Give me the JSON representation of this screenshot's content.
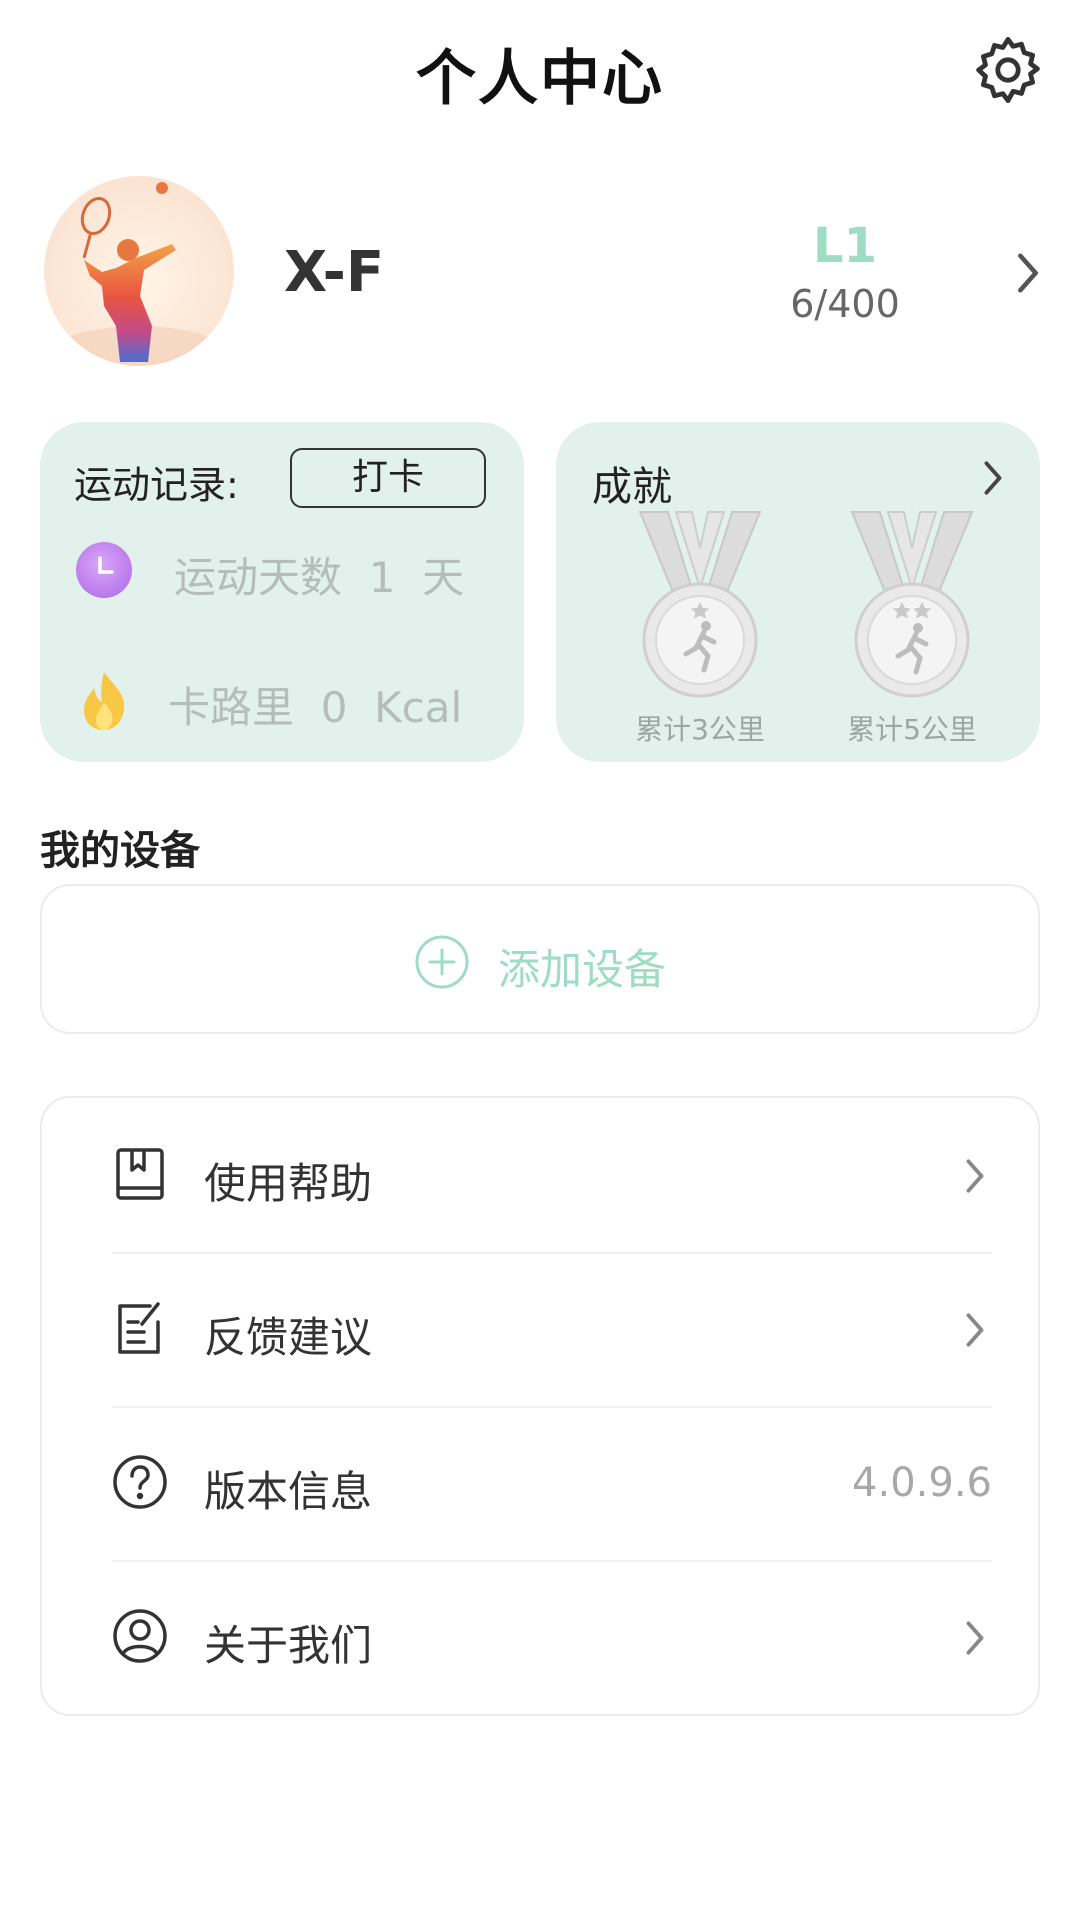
{
  "header": {
    "title": "个人中心"
  },
  "profile": {
    "username": "X-F",
    "level": "L1",
    "level_progress": "6/400"
  },
  "records": {
    "label": "运动记录:",
    "checkin_label": "打卡",
    "days_text": "运动天数  1  天",
    "calories_text": "卡路里  0  Kcal"
  },
  "achievements": {
    "title": "成就",
    "medals": [
      {
        "label": "累计3公里"
      },
      {
        "label": "累计5公里"
      }
    ]
  },
  "devices": {
    "section_title": "我的设备",
    "add_label": "添加设备"
  },
  "menu": {
    "items": [
      {
        "label": "使用帮助",
        "icon": "book-icon"
      },
      {
        "label": "反馈建议",
        "icon": "feedback-icon"
      },
      {
        "label": "版本信息",
        "icon": "question-icon",
        "value": "4.0.9.6"
      },
      {
        "label": "关于我们",
        "icon": "user-circle-icon"
      }
    ]
  },
  "colors": {
    "accent": "#9fdcc4",
    "card_bg": "#e2f1eb",
    "clock_purple": "#c88af0",
    "flame_yellow": "#f5c542"
  }
}
